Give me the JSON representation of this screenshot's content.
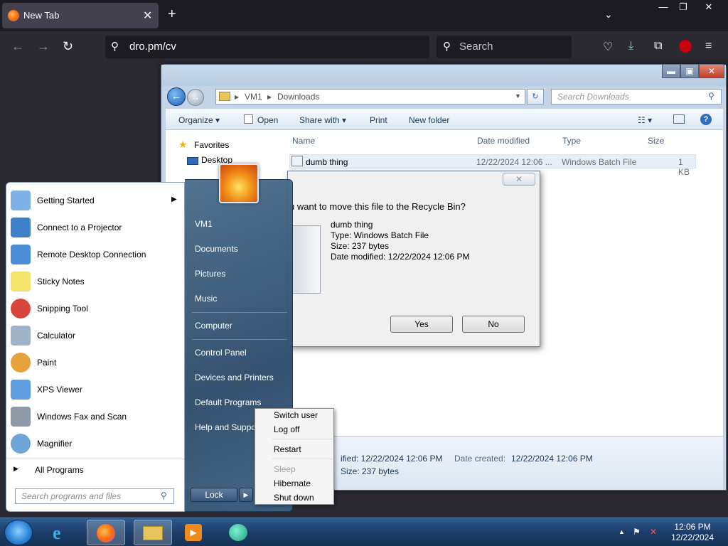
{
  "firefox": {
    "tab_title": "New Tab",
    "tab_close": "✕",
    "new_tab": "+",
    "list_tabs": "⌄",
    "min": "—",
    "max": "❐",
    "close": "✕",
    "back": "←",
    "forward": "→",
    "reload": "↻",
    "url": "dro.pm/cv",
    "search_placeholder": "Search",
    "icons": [
      "pocket-icon",
      "downloads-icon",
      "extensions-icon",
      "ublock-icon",
      "menu-icon"
    ]
  },
  "explorer": {
    "min": "▬",
    "max": "▣",
    "close": "✕",
    "breadcrumb": [
      "VM1",
      "Downloads"
    ],
    "search_placeholder": "Search Downloads",
    "commands": [
      "Organize ▾",
      "Open",
      "Share with ▾",
      "Print",
      "New folder"
    ],
    "nav": {
      "favorites": "Favorites",
      "desktop": "Desktop"
    },
    "columns": [
      "Name",
      "Date modified",
      "Type",
      "Size"
    ],
    "row": {
      "name": "dumb thing",
      "date": "12/22/2024 12:06 ...",
      "type": "Windows Batch File",
      "size": "1 KB"
    },
    "details": {
      "modified": "ified: 12/22/2024 12:06 PM",
      "created_label": "Date created:",
      "created": "12/22/2024 12:06 PM",
      "size": "Size: 237 bytes"
    }
  },
  "dialog": {
    "close": "✕",
    "question": "u want to move this file to the Recycle Bin?",
    "file_name": "dumb thing",
    "file_type": "Type: Windows Batch File",
    "file_size": "Size: 237 bytes",
    "file_date": "Date modified: 12/22/2024 12:06 PM",
    "yes": "Yes",
    "no": "No"
  },
  "start_menu": {
    "programs": [
      {
        "label": "Getting Started",
        "color": "#7fb2e6"
      },
      {
        "label": "Connect to a Projector",
        "color": "#3d7fc8"
      },
      {
        "label": "Remote Desktop Connection",
        "color": "#4a8ed6"
      },
      {
        "label": "Sticky Notes",
        "color": "#f4e36a"
      },
      {
        "label": "Snipping Tool",
        "color": "#d9453a"
      },
      {
        "label": "Calculator",
        "color": "#9fb4c9"
      },
      {
        "label": "Paint",
        "color": "#e7a23a"
      },
      {
        "label": "XPS Viewer",
        "color": "#5c9ee0"
      },
      {
        "label": "Windows Fax and Scan",
        "color": "#8e9aa8"
      },
      {
        "label": "Magnifier",
        "color": "#6fa6d8"
      }
    ],
    "arrow": "▶",
    "all_programs": "All Programs",
    "all_arrow": "▶",
    "search_placeholder": "Search programs and files",
    "right": [
      "VM1",
      "Documents",
      "Pictures",
      "Music",
      "Computer",
      "Control Panel",
      "Devices and Printers",
      "Default Programs",
      "Help and Support"
    ],
    "lock": "Lock",
    "lock_arrow": "▶",
    "power_menu": [
      "Switch user",
      "Log off",
      "Restart",
      "Sleep",
      "Hibernate",
      "Shut down"
    ]
  },
  "taskbar": {
    "time": "12:06 PM",
    "date": "12/22/2024",
    "tray_arrow": "▲"
  }
}
